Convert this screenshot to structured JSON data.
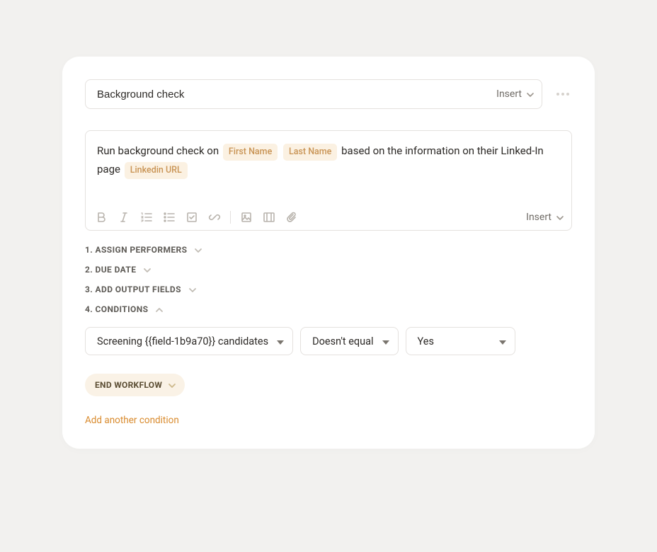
{
  "title": {
    "value": "Background check",
    "insert_label": "Insert"
  },
  "editor": {
    "text_before_names": "Run background check on",
    "token_first_name": "First Name",
    "token_last_name": "Last Name",
    "text_mid": "based on the information on their Linked-In page",
    "token_linkedin": "Linkedin URL",
    "insert_label": "Insert"
  },
  "sections": {
    "s1": "1. ASSIGN PERFORMERS",
    "s2": "2. DUE DATE",
    "s3": "3. ADD OUTPUT FIELDS",
    "s4": "4. CONDITIONS"
  },
  "condition": {
    "field": "Screening {{field-1b9a70}} candidates",
    "operator": "Doesn't equal",
    "value": "Yes",
    "end_workflow": "END WORKFLOW",
    "add_another": "Add another condition"
  }
}
